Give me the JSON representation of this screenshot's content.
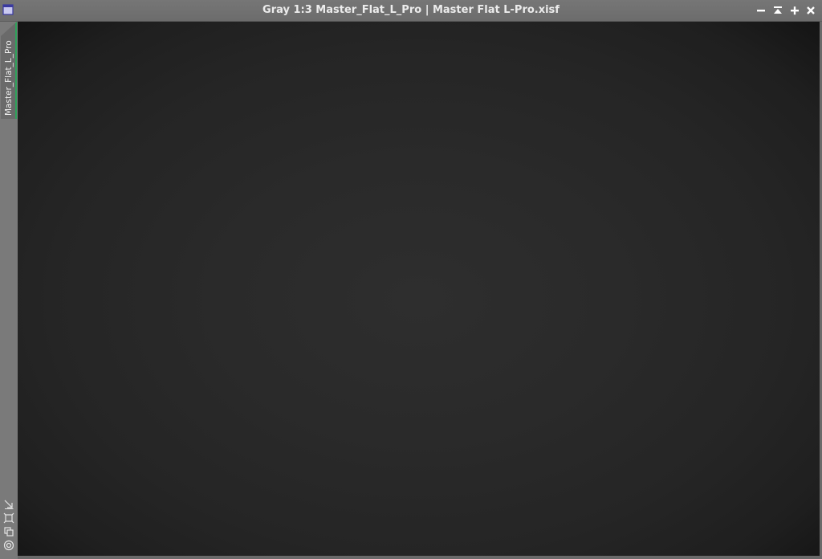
{
  "window": {
    "title": "Gray 1:3 Master_Flat_L_Pro | Master Flat L-Pro.xisf",
    "view_tab_label": "Master_Flat_L_Pro",
    "controls": [
      "minimize-icon",
      "shade-icon",
      "maximize-icon",
      "close-icon"
    ],
    "accent_color": "#2fa05a"
  },
  "left_strip": {
    "tools": [
      "fit-view-icon",
      "zoom-to-fit-icon",
      "clone-view-icon",
      "target-icon"
    ]
  }
}
